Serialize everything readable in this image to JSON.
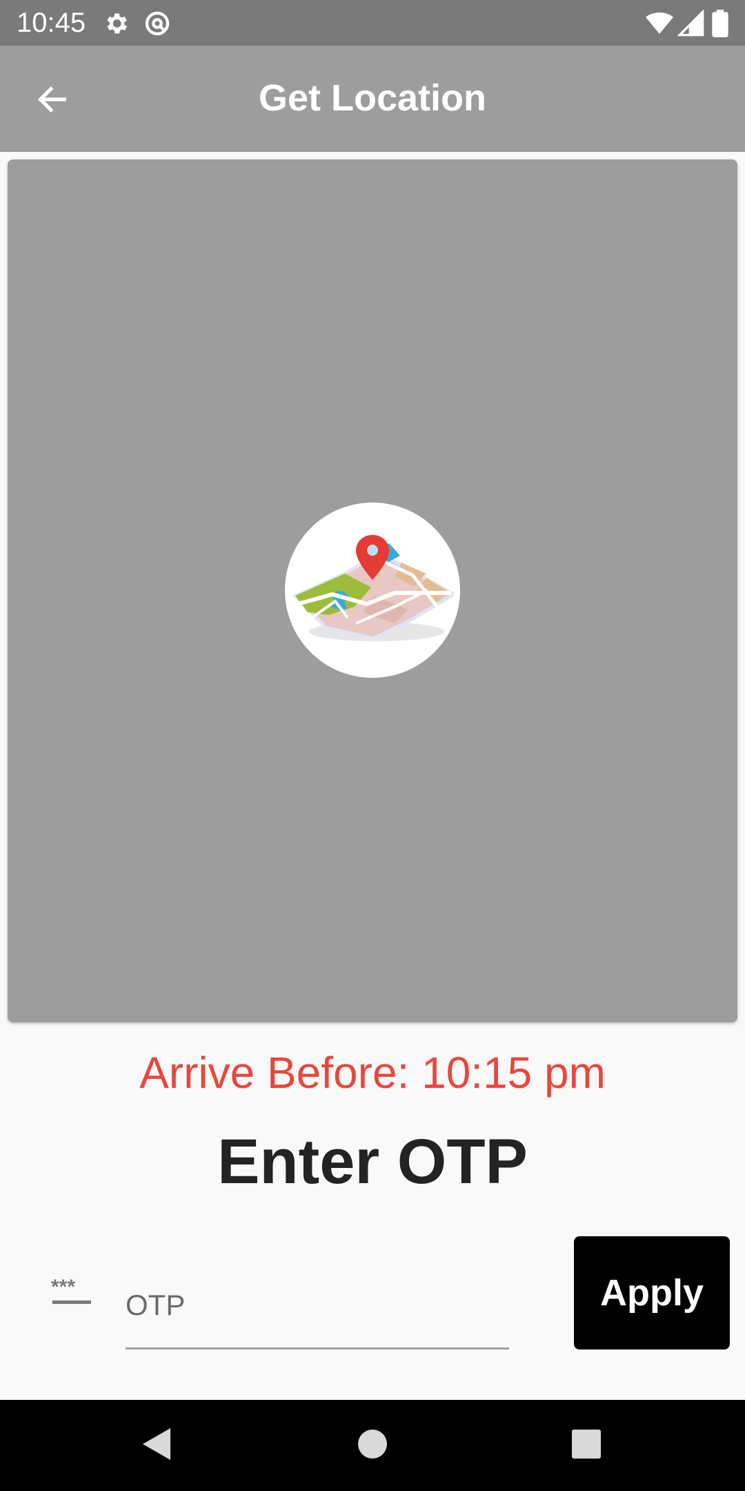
{
  "status_bar": {
    "time": "10:45",
    "icons": [
      "settings-icon",
      "at-sign-icon",
      "wifi-icon",
      "signal-icon",
      "battery-icon"
    ]
  },
  "app_bar": {
    "title": "Get Location",
    "back_icon": "arrow-left-icon"
  },
  "map": {
    "placeholder_icon": "map-pin-illustration"
  },
  "arrival": {
    "text": "Arrive Before: 10:15 pm",
    "color": "#e8473c"
  },
  "otp": {
    "heading": "Enter OTP",
    "icon": "password-icon",
    "placeholder": "OTP",
    "value": "",
    "apply_label": "Apply"
  },
  "nav_bar": {
    "buttons": [
      "back-triangle-icon",
      "home-circle-icon",
      "recents-square-icon"
    ]
  },
  "colors": {
    "status_bar": "#7a7a7a",
    "app_bar": "#9d9d9d",
    "map_background": "#9d9d9d",
    "apply_button": "#000000",
    "nav_bar": "#000000"
  }
}
